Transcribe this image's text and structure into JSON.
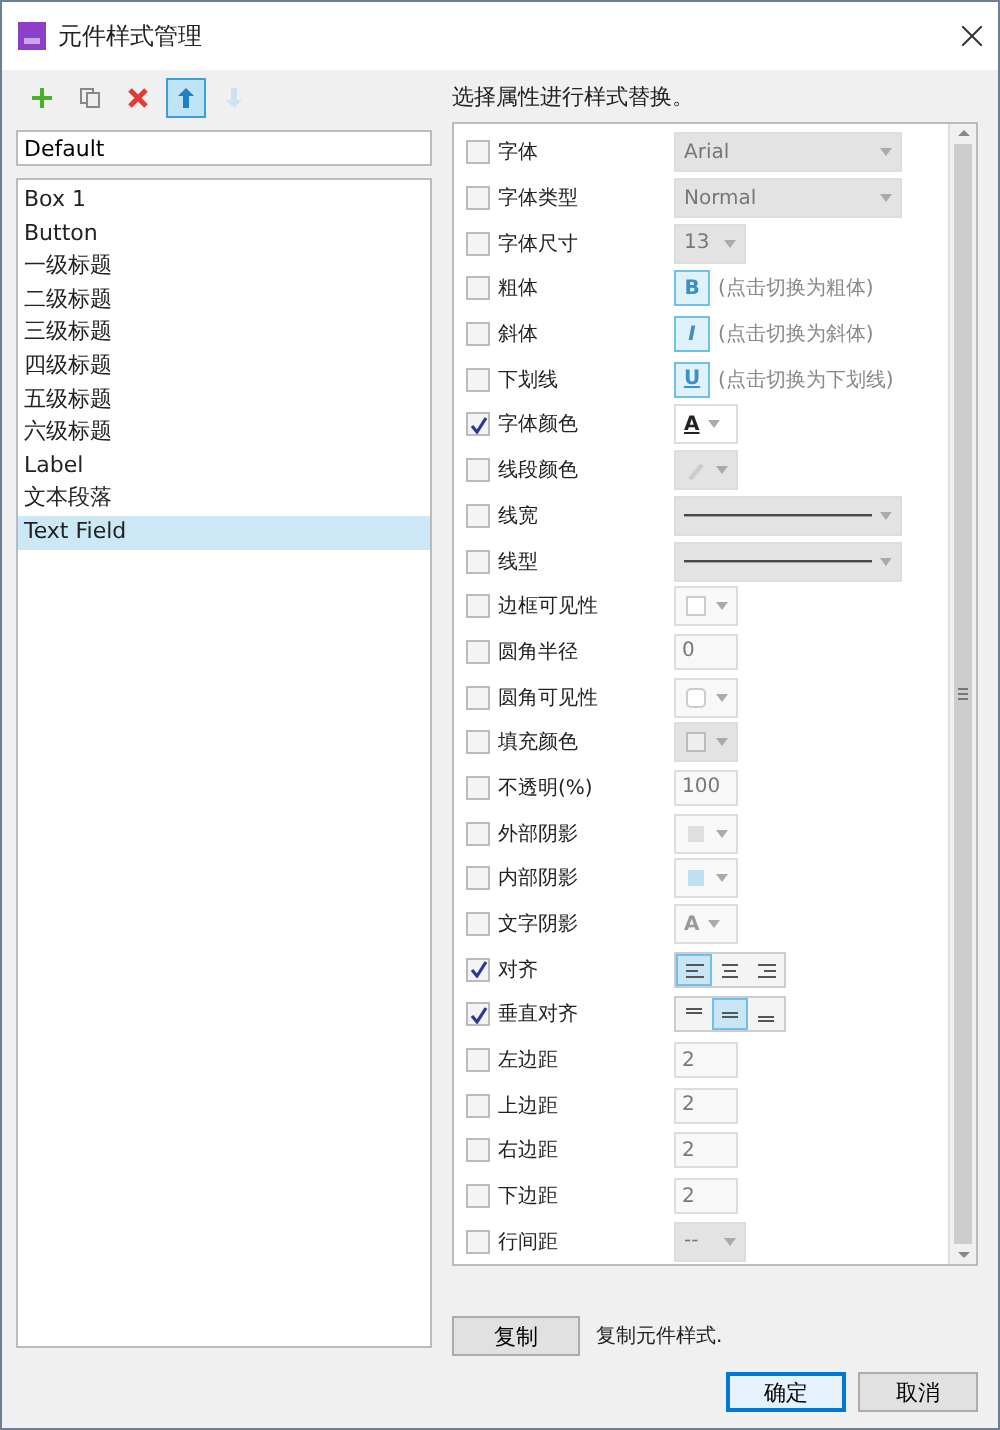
{
  "window": {
    "title": "元件样式管理"
  },
  "toolbar": [
    {
      "kind": "add",
      "highlighted": false,
      "disabled": false
    },
    {
      "kind": "copy",
      "highlighted": false,
      "disabled": false
    },
    {
      "kind": "delete",
      "highlighted": false,
      "disabled": false
    },
    {
      "kind": "up",
      "highlighted": true,
      "disabled": false
    },
    {
      "kind": "down",
      "highlighted": false,
      "disabled": true
    }
  ],
  "style_name": {
    "value": "Default"
  },
  "styles": [
    {
      "label": "Box 1",
      "selected": false
    },
    {
      "label": "Button",
      "selected": false
    },
    {
      "label": "一级标题",
      "selected": false
    },
    {
      "label": "二级标题",
      "selected": false
    },
    {
      "label": "三级标题",
      "selected": false
    },
    {
      "label": "四级标题",
      "selected": false
    },
    {
      "label": "五级标题",
      "selected": false
    },
    {
      "label": "六级标题",
      "selected": false
    },
    {
      "label": "Label",
      "selected": false
    },
    {
      "label": "文本段落",
      "selected": false
    },
    {
      "label": "Text Field",
      "selected": true
    }
  ],
  "instruction": "选择属性进行样式替换。",
  "properties": [
    {
      "label": "字体",
      "checked": false,
      "kind": "select",
      "value": "Arial"
    },
    {
      "label": "字体类型",
      "checked": false,
      "kind": "select",
      "value": "Normal"
    },
    {
      "label": "字体尺寸",
      "checked": false,
      "kind": "small-select",
      "value": "13"
    },
    {
      "label": "粗体",
      "checked": false,
      "kind": "toggle",
      "glyph": "B",
      "hint": "(点击切换为粗体)"
    },
    {
      "label": "斜体",
      "checked": false,
      "kind": "toggle",
      "glyph": "I",
      "hint": "(点击切换为斜体)"
    },
    {
      "label": "下划线",
      "checked": false,
      "kind": "toggle",
      "glyph": "U",
      "hint": "(点击切换为下划线)"
    },
    {
      "label": "字体颜色",
      "checked": true,
      "kind": "font-color",
      "glyph": "A"
    },
    {
      "label": "线段颜色",
      "checked": false,
      "kind": "pen"
    },
    {
      "label": "线宽",
      "checked": false,
      "kind": "line"
    },
    {
      "label": "线型",
      "checked": false,
      "kind": "line"
    },
    {
      "label": "边框可见性",
      "checked": false,
      "kind": "border"
    },
    {
      "label": "圆角半径",
      "checked": false,
      "kind": "number",
      "value": "0"
    },
    {
      "label": "圆角可见性",
      "checked": false,
      "kind": "corner"
    },
    {
      "label": "填充颜色",
      "checked": false,
      "kind": "fill"
    },
    {
      "label": "不透明(%)",
      "checked": false,
      "kind": "number",
      "value": "100"
    },
    {
      "label": "外部阴影",
      "checked": false,
      "kind": "shadow"
    },
    {
      "label": "内部阴影",
      "checked": false,
      "kind": "innershadow"
    },
    {
      "label": "文字阴影",
      "checked": false,
      "kind": "text-shadow",
      "glyph": "A"
    },
    {
      "label": "对齐",
      "checked": true,
      "kind": "align",
      "options": [
        {
          "kind": "left",
          "selected": true
        },
        {
          "kind": "center",
          "selected": false
        },
        {
          "kind": "right",
          "selected": false
        }
      ]
    },
    {
      "label": "垂直对齐",
      "checked": true,
      "kind": "align",
      "options": [
        {
          "kind": "top",
          "selected": false
        },
        {
          "kind": "middle",
          "selected": true
        },
        {
          "kind": "bottom",
          "selected": false
        }
      ]
    },
    {
      "label": "左边距",
      "checked": false,
      "kind": "number",
      "value": "2"
    },
    {
      "label": "上边距",
      "checked": false,
      "kind": "number",
      "value": "2"
    },
    {
      "label": "右边距",
      "checked": false,
      "kind": "number",
      "value": "2"
    },
    {
      "label": "下边距",
      "checked": false,
      "kind": "number",
      "value": "2"
    },
    {
      "label": "行间距",
      "checked": false,
      "kind": "small-select",
      "value": "--"
    }
  ],
  "copy_button": "复制",
  "copy_hint": "复制元件样式.",
  "buttons": [
    {
      "label": "确定",
      "kind": "primary"
    },
    {
      "label": "取消",
      "kind": "secondary"
    }
  ]
}
